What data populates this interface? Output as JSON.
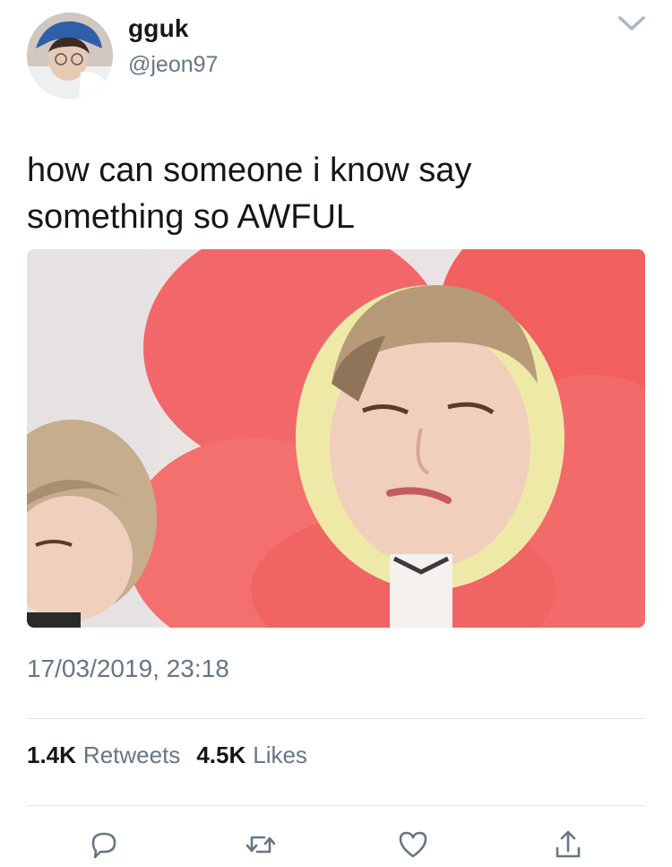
{
  "user": {
    "display_name": "gguk",
    "handle": "@jeon97"
  },
  "tweet": {
    "text": "how can someone i know say\nsomething so AWFUL",
    "timestamp": "17/03/2019, 23:18"
  },
  "stats": {
    "retweets_count": "1.4K",
    "retweets_label": "Retweets",
    "likes_count": "4.5K",
    "likes_label": "Likes"
  },
  "icons": {
    "menu": "chevron-down-icon",
    "reply": "reply-icon",
    "retweet": "retweet-icon",
    "like": "heart-icon",
    "share": "share-icon"
  },
  "colors": {
    "text": "#14171a",
    "secondary": "#657786",
    "divider": "#e1e8ed",
    "petal": "#f0685f"
  }
}
